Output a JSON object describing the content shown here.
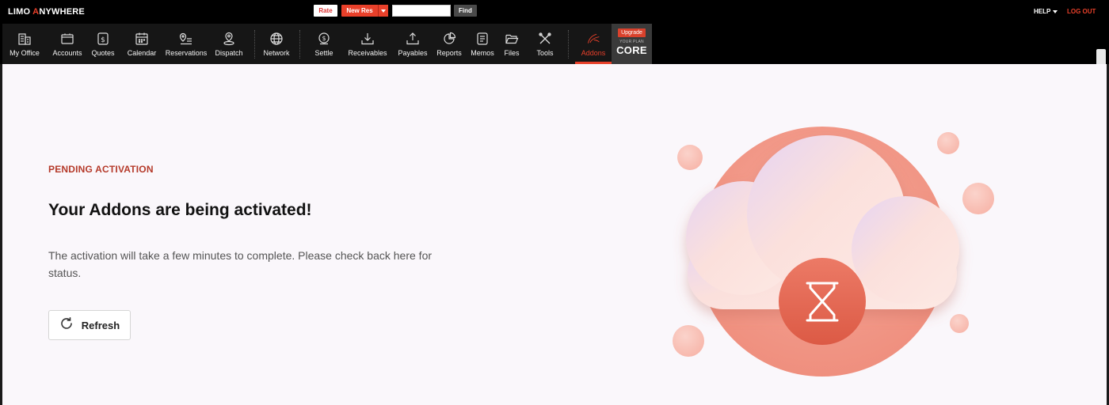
{
  "topbar": {
    "logo_left": "LIMO ",
    "logo_accent": "A",
    "logo_right": "NYWHERE",
    "rate_label": "Rate",
    "newres_label": "New Res",
    "search_value": "",
    "find_label": "Find",
    "help_label": "HELP",
    "logout_label": "LOG OUT"
  },
  "nav": {
    "items": [
      {
        "label": "My Office",
        "icon": "building-icon"
      },
      {
        "label": "Accounts",
        "icon": "folder-account-icon"
      },
      {
        "label": "Quotes",
        "icon": "dollar-document-icon"
      },
      {
        "label": "Calendar",
        "icon": "calendar-icon"
      },
      {
        "label": "Reservations",
        "icon": "pin-list-icon"
      },
      {
        "label": "Dispatch",
        "icon": "location-pin-icon"
      },
      {
        "label": "Network",
        "icon": "globe-icon"
      },
      {
        "label": "Settle",
        "icon": "coin-icon"
      },
      {
        "label": "Receivables",
        "icon": "download-tray-icon"
      },
      {
        "label": "Payables",
        "icon": "upload-tray-icon"
      },
      {
        "label": "Reports",
        "icon": "pie-chart-icon"
      },
      {
        "label": "Memos",
        "icon": "memo-icon"
      },
      {
        "label": "Files",
        "icon": "open-folder-icon"
      },
      {
        "label": "Tools",
        "icon": "tools-icon"
      },
      {
        "label": "Addons",
        "icon": "addons-swoosh-icon"
      }
    ],
    "active": "Addons",
    "accent_color": "#e8402a"
  },
  "plan": {
    "upgrade_label": "Upgrade",
    "plan_caption": "YOUR PLAN",
    "plan_name": "CORE"
  },
  "main": {
    "status_label": "PENDING ACTIVATION",
    "title": "Your Addons are being activated!",
    "description": "The activation will take a few minutes to complete. Please check back here for status.",
    "refresh_label": "Refresh",
    "illustration_icon": "hourglass-icon"
  }
}
